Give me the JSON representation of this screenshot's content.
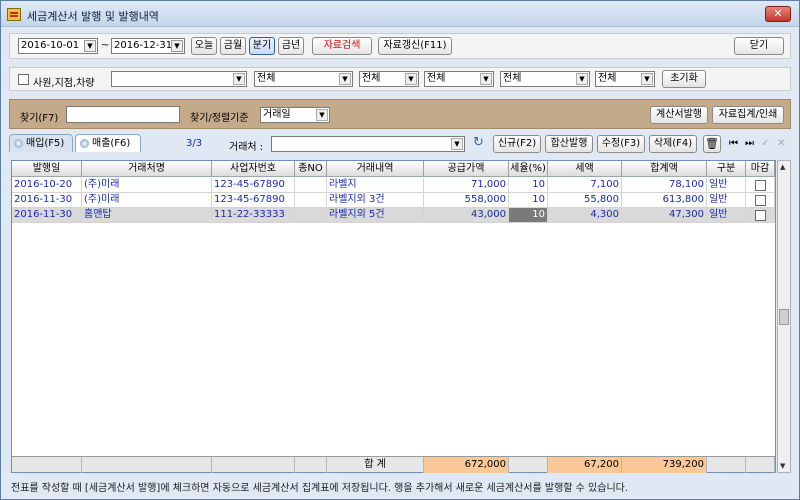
{
  "window": {
    "title": "세금계산서 발행 및 발행내역",
    "close": "✕"
  },
  "toolbar": {
    "date_from": "2016-10-01",
    "date_sep": "~",
    "date_to": "2016-12-31",
    "today": "오늘",
    "month": "금월",
    "quarter": "분기",
    "year": "금년",
    "search": "자료검색",
    "refresh": "자료갱신(F11)",
    "close": "닫기"
  },
  "filter": {
    "label": "사원,지점,차량",
    "selects": [
      "",
      "전체",
      "전체",
      "전체",
      "전체",
      "전체"
    ],
    "reset": "초기화"
  },
  "findbar": {
    "find_label": "찾기(F7)",
    "sort_label": "찾기/정렬기준",
    "sort_value": "거래일",
    "issue_btn": "계산서발행",
    "summary_btn": "자료집계/인쇄"
  },
  "tabs": [
    {
      "label": "매입(F5)"
    },
    {
      "label": "매출(F6)"
    }
  ],
  "nav": {
    "count": "3/3",
    "partner_label": "거래처 :",
    "new": "신규(F2)",
    "combined": "합산발행",
    "edit": "수정(F3)",
    "delete": "삭제(F4)"
  },
  "table": {
    "headers": [
      "발행일",
      "거래처명",
      "사업자번호",
      "종NO",
      "거래내역",
      "공급가액",
      "세율(%)",
      "세액",
      "합계액",
      "구분",
      "마감"
    ],
    "rows": [
      {
        "date": "2016-10-20",
        "name": "(주)미래",
        "bizno": "123-45-67890",
        "no": "",
        "desc": "라벨지",
        "supply": "71,000",
        "rate": "10",
        "tax": "7,100",
        "total": "78,100",
        "type": "일반"
      },
      {
        "date": "2016-11-30",
        "name": "(주)미래",
        "bizno": "123-45-67890",
        "no": "",
        "desc": "라벨지외 3건",
        "supply": "558,000",
        "rate": "10",
        "tax": "55,800",
        "total": "613,800",
        "type": "일반"
      },
      {
        "date": "2016-11-30",
        "name": "홈앤탑",
        "bizno": "111-22-33333",
        "no": "",
        "desc": "라벨지외 5건",
        "supply": "43,000",
        "rate": "10",
        "tax": "4,300",
        "total": "47,300",
        "type": "일반"
      }
    ],
    "footer": {
      "label": "합    계",
      "supply": "672,000",
      "tax": "67,200",
      "total": "739,200"
    }
  },
  "status": "전표를 작성할 때 [세금계산서 발행]에 체크하면 자동으로 세금계산서 집계표에 저장됩니다. 행을 추가해서 새로운 세금계산서를 발행할 수 있습니다."
}
